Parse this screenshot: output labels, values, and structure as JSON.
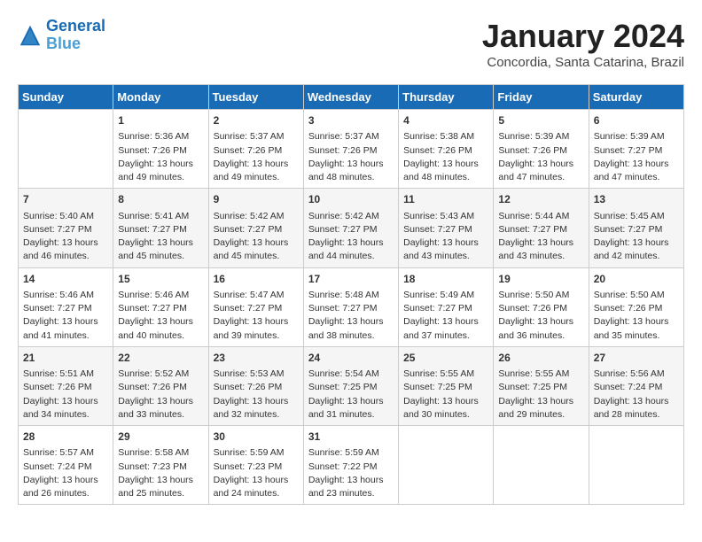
{
  "header": {
    "logo_line1": "General",
    "logo_line2": "Blue",
    "month": "January 2024",
    "location": "Concordia, Santa Catarina, Brazil"
  },
  "days_of_week": [
    "Sunday",
    "Monday",
    "Tuesday",
    "Wednesday",
    "Thursday",
    "Friday",
    "Saturday"
  ],
  "weeks": [
    [
      {
        "day": "",
        "empty": true
      },
      {
        "day": "1",
        "sunrise": "5:36 AM",
        "sunset": "7:26 PM",
        "daylight": "13 hours and 49 minutes."
      },
      {
        "day": "2",
        "sunrise": "5:37 AM",
        "sunset": "7:26 PM",
        "daylight": "13 hours and 49 minutes."
      },
      {
        "day": "3",
        "sunrise": "5:37 AM",
        "sunset": "7:26 PM",
        "daylight": "13 hours and 48 minutes."
      },
      {
        "day": "4",
        "sunrise": "5:38 AM",
        "sunset": "7:26 PM",
        "daylight": "13 hours and 48 minutes."
      },
      {
        "day": "5",
        "sunrise": "5:39 AM",
        "sunset": "7:26 PM",
        "daylight": "13 hours and 47 minutes."
      },
      {
        "day": "6",
        "sunrise": "5:39 AM",
        "sunset": "7:27 PM",
        "daylight": "13 hours and 47 minutes."
      }
    ],
    [
      {
        "day": "7",
        "sunrise": "5:40 AM",
        "sunset": "7:27 PM",
        "daylight": "13 hours and 46 minutes."
      },
      {
        "day": "8",
        "sunrise": "5:41 AM",
        "sunset": "7:27 PM",
        "daylight": "13 hours and 45 minutes."
      },
      {
        "day": "9",
        "sunrise": "5:42 AM",
        "sunset": "7:27 PM",
        "daylight": "13 hours and 45 minutes."
      },
      {
        "day": "10",
        "sunrise": "5:42 AM",
        "sunset": "7:27 PM",
        "daylight": "13 hours and 44 minutes."
      },
      {
        "day": "11",
        "sunrise": "5:43 AM",
        "sunset": "7:27 PM",
        "daylight": "13 hours and 43 minutes."
      },
      {
        "day": "12",
        "sunrise": "5:44 AM",
        "sunset": "7:27 PM",
        "daylight": "13 hours and 43 minutes."
      },
      {
        "day": "13",
        "sunrise": "5:45 AM",
        "sunset": "7:27 PM",
        "daylight": "13 hours and 42 minutes."
      }
    ],
    [
      {
        "day": "14",
        "sunrise": "5:46 AM",
        "sunset": "7:27 PM",
        "daylight": "13 hours and 41 minutes."
      },
      {
        "day": "15",
        "sunrise": "5:46 AM",
        "sunset": "7:27 PM",
        "daylight": "13 hours and 40 minutes."
      },
      {
        "day": "16",
        "sunrise": "5:47 AM",
        "sunset": "7:27 PM",
        "daylight": "13 hours and 39 minutes."
      },
      {
        "day": "17",
        "sunrise": "5:48 AM",
        "sunset": "7:27 PM",
        "daylight": "13 hours and 38 minutes."
      },
      {
        "day": "18",
        "sunrise": "5:49 AM",
        "sunset": "7:27 PM",
        "daylight": "13 hours and 37 minutes."
      },
      {
        "day": "19",
        "sunrise": "5:50 AM",
        "sunset": "7:26 PM",
        "daylight": "13 hours and 36 minutes."
      },
      {
        "day": "20",
        "sunrise": "5:50 AM",
        "sunset": "7:26 PM",
        "daylight": "13 hours and 35 minutes."
      }
    ],
    [
      {
        "day": "21",
        "sunrise": "5:51 AM",
        "sunset": "7:26 PM",
        "daylight": "13 hours and 34 minutes."
      },
      {
        "day": "22",
        "sunrise": "5:52 AM",
        "sunset": "7:26 PM",
        "daylight": "13 hours and 33 minutes."
      },
      {
        "day": "23",
        "sunrise": "5:53 AM",
        "sunset": "7:26 PM",
        "daylight": "13 hours and 32 minutes."
      },
      {
        "day": "24",
        "sunrise": "5:54 AM",
        "sunset": "7:25 PM",
        "daylight": "13 hours and 31 minutes."
      },
      {
        "day": "25",
        "sunrise": "5:55 AM",
        "sunset": "7:25 PM",
        "daylight": "13 hours and 30 minutes."
      },
      {
        "day": "26",
        "sunrise": "5:55 AM",
        "sunset": "7:25 PM",
        "daylight": "13 hours and 29 minutes."
      },
      {
        "day": "27",
        "sunrise": "5:56 AM",
        "sunset": "7:24 PM",
        "daylight": "13 hours and 28 minutes."
      }
    ],
    [
      {
        "day": "28",
        "sunrise": "5:57 AM",
        "sunset": "7:24 PM",
        "daylight": "13 hours and 26 minutes."
      },
      {
        "day": "29",
        "sunrise": "5:58 AM",
        "sunset": "7:23 PM",
        "daylight": "13 hours and 25 minutes."
      },
      {
        "day": "30",
        "sunrise": "5:59 AM",
        "sunset": "7:23 PM",
        "daylight": "13 hours and 24 minutes."
      },
      {
        "day": "31",
        "sunrise": "5:59 AM",
        "sunset": "7:22 PM",
        "daylight": "13 hours and 23 minutes."
      },
      {
        "day": "",
        "empty": true
      },
      {
        "day": "",
        "empty": true
      },
      {
        "day": "",
        "empty": true
      }
    ]
  ]
}
